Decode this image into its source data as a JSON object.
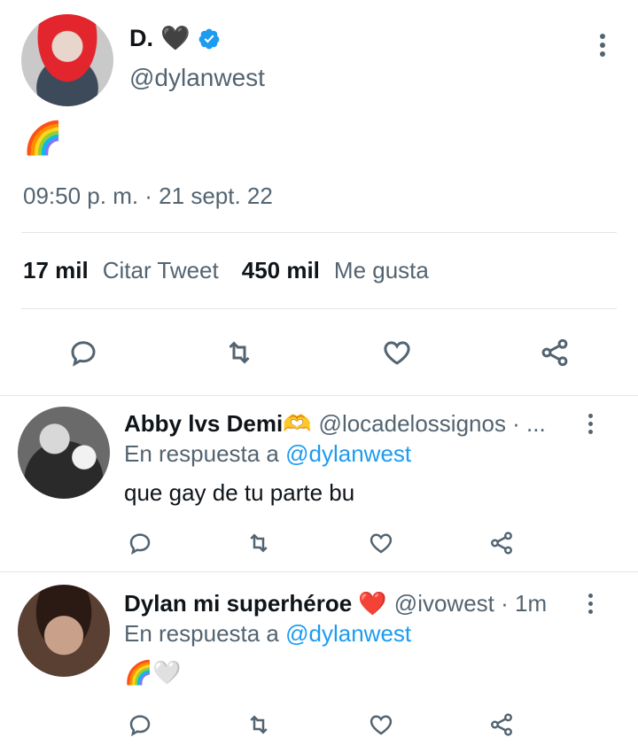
{
  "main_tweet": {
    "display_name": "D.",
    "name_emoji": "🖤",
    "handle": "@dylanwest",
    "text": "🌈",
    "timestamp": "09:50 p. m. · 21 sept. 22",
    "quote_count": "17 mil",
    "quote_label": "Citar Tweet",
    "like_count": "450 mil",
    "like_label": "Me gusta",
    "verified_color": "#1d9bf0"
  },
  "replies": [
    {
      "display_name": "Abby lvs Demi🫶",
      "handle_meta": "@locadelossignos · ...",
      "reply_prefix": "En respuesta a",
      "reply_to": "@dylanwest",
      "text": "que gay de tu parte bu"
    },
    {
      "display_name": "Dylan mi superhéroe ❤️",
      "handle_meta": "@ivowest · 1m",
      "reply_prefix": "En respuesta a",
      "reply_to": "@dylanwest",
      "text": "🌈🤍"
    }
  ],
  "icons": {
    "reply": "reply-icon",
    "retweet": "retweet-icon",
    "like": "heart-icon",
    "share": "share-icon",
    "more": "more-vertical-icon"
  },
  "colors": {
    "link": "#1d9bf0",
    "secondary": "#536471",
    "divider": "#e1e6ea"
  }
}
